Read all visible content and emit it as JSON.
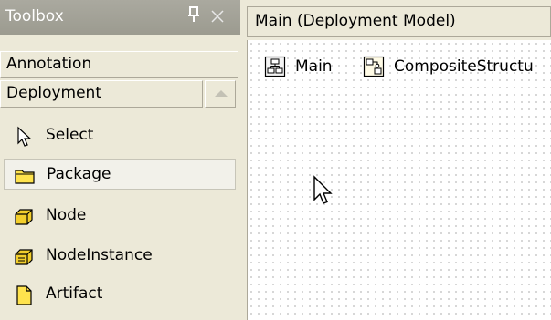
{
  "toolbox": {
    "title": "Toolbox",
    "pin_icon": "pin-icon",
    "close_icon": "close-icon",
    "categories": [
      {
        "label": "Annotation"
      },
      {
        "label": "Deployment"
      }
    ],
    "items": [
      {
        "label": "Select",
        "icon": "pointer-icon"
      },
      {
        "label": "Package",
        "icon": "package-folder-icon"
      },
      {
        "label": "Node",
        "icon": "node-cube-icon"
      },
      {
        "label": "NodeInstance",
        "icon": "node-instance-icon"
      },
      {
        "label": "Artifact",
        "icon": "artifact-icon"
      }
    ]
  },
  "document": {
    "title": "Main (Deployment Model)",
    "diagram_tabs": [
      {
        "label": "Main",
        "icon": "diagram-main-icon"
      },
      {
        "label": "CompositeStructu",
        "icon": "composite-structure-icon"
      }
    ]
  },
  "colors": {
    "titlebar": "#9c9b90",
    "panel": "#ece9d8",
    "folder_yellow": "#ffe34d",
    "cube_yellow": "#f3cf2c"
  }
}
